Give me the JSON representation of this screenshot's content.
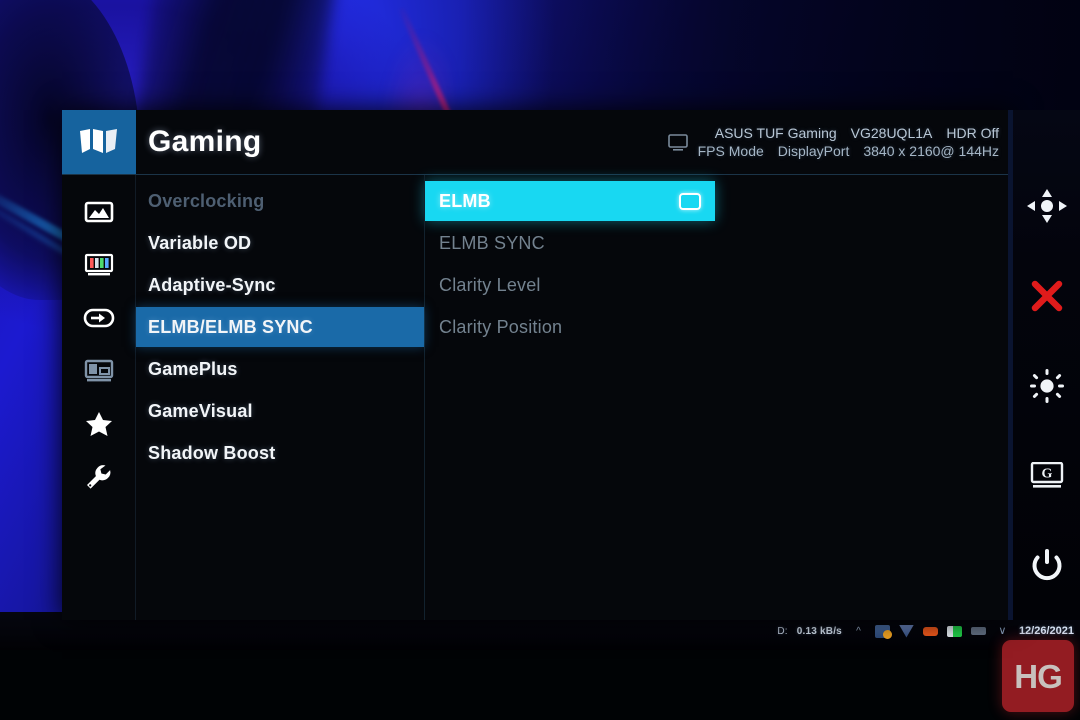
{
  "osd": {
    "brand_logo": "tuf-gaming-logo",
    "title": "Gaming",
    "info": {
      "monitor_icon": "monitor-icon",
      "brand": "ASUS TUF Gaming",
      "model": "VG28UQL1A",
      "hdr_status": "HDR Off",
      "preset_mode": "FPS Mode",
      "input_source": "DisplayPort",
      "resolution": "3840 x 2160@ 144Hz"
    },
    "rail_icons": [
      {
        "name": "image-icon",
        "label": "Image"
      },
      {
        "name": "color-icon",
        "label": "Color"
      },
      {
        "name": "input-select-icon",
        "label": "Input Select"
      },
      {
        "name": "pip-pbp-icon",
        "label": "PIP/PBP"
      },
      {
        "name": "star-icon",
        "label": "MyFavorite"
      },
      {
        "name": "wrench-icon",
        "label": "System Setup"
      }
    ],
    "menu_items": [
      {
        "label": "Overclocking",
        "state": "disabled"
      },
      {
        "label": "Variable OD",
        "state": "normal"
      },
      {
        "label": "Adaptive-Sync",
        "state": "normal"
      },
      {
        "label": "ELMB/ELMB SYNC",
        "state": "selected"
      },
      {
        "label": "GamePlus",
        "state": "normal"
      },
      {
        "label": "GameVisual",
        "state": "normal"
      },
      {
        "label": "Shadow Boost",
        "state": "normal"
      }
    ],
    "submenu_items": [
      {
        "label": "ELMB",
        "state": "highlight",
        "icon": "toggle-box-icon"
      },
      {
        "label": "ELMB SYNC",
        "state": "normal",
        "icon": ""
      },
      {
        "label": "Clarity Level",
        "state": "normal",
        "icon": ""
      },
      {
        "label": "Clarity Position",
        "state": "normal",
        "icon": ""
      }
    ],
    "colors": {
      "brand_blue": "#16639e",
      "selected_blue": "#1a6aa8",
      "highlight_cyan": "#18d8f2",
      "panel_bg": "#05070b",
      "disabled_text": "#4e5f72",
      "dim_text": "#73828f",
      "close_red": "#e01b1b"
    }
  },
  "control_rail": {
    "buttons": [
      {
        "name": "joystick-navigation-icon",
        "label": "Navigate"
      },
      {
        "name": "close-icon",
        "label": "Close"
      },
      {
        "name": "brightness-icon",
        "label": "Brightness"
      },
      {
        "name": "gamevisual-icon",
        "label": "GameVisual"
      },
      {
        "name": "power-icon",
        "label": "Power"
      }
    ]
  },
  "taskbar": {
    "drive_label": "D:",
    "network_speed": "0.13 kB/s",
    "tray_icons": [
      "caret-up-icon",
      "folder-icon",
      "shield-icon",
      "orange-app-icon",
      "green-battery-icon",
      "grey-app-icon",
      "chevron-icon"
    ],
    "date": "12/26/2021"
  },
  "watermark": {
    "label": "HG"
  }
}
